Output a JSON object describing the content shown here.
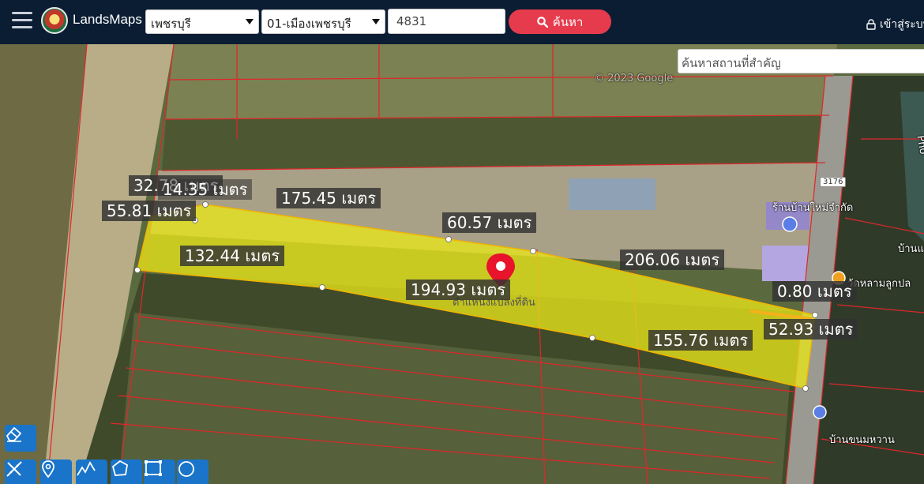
{
  "header": {
    "app_name": "LandsMaps",
    "province": "เพชรบุรี",
    "district": "01-เมืองเพชรบุรี",
    "parcel_no": "4831",
    "search_label": "ค้นหา",
    "login_label": "เข้าสู่ระบบ"
  },
  "map": {
    "place_search_placeholder": "ค้นหาสถานที่สำคัญ",
    "parcel_caption": "ตำแหน่งแปลงที่ดิน",
    "copyright": "© 2023 Google",
    "road_number": "3176",
    "poi": {
      "shop": "ร้านบ้านใหม่จำกัด",
      "village1": "บ้านแ",
      "village2": "บ้านขนมหวาน",
      "temple": "วัดหลามลูกปล",
      "river": "Pho"
    },
    "measurements": [
      {
        "id": "m1",
        "text": "32.78 เมตร"
      },
      {
        "id": "m2",
        "text": "14.35 เมตร"
      },
      {
        "id": "m3",
        "text": "175.45 เมตร"
      },
      {
        "id": "m4",
        "text": "55.81 เมตร"
      },
      {
        "id": "m5",
        "text": "60.57 เมตร"
      },
      {
        "id": "m6",
        "text": "132.44 เมตร"
      },
      {
        "id": "m7",
        "text": "206.06 เมตร"
      },
      {
        "id": "m8",
        "text": "194.93 เมตร"
      },
      {
        "id": "m9",
        "text": "0.80 เมตร"
      },
      {
        "id": "m10",
        "text": "52.93 เมตร"
      },
      {
        "id": "m11",
        "text": "155.76 เมตร"
      }
    ]
  },
  "tools": [
    {
      "id": "eraser",
      "icon": "eraser-icon"
    },
    {
      "id": "ruler",
      "icon": "ruler-icon"
    },
    {
      "id": "marker",
      "icon": "map-pin-icon"
    },
    {
      "id": "polyline",
      "icon": "polyline-icon"
    },
    {
      "id": "polygon",
      "icon": "polygon-icon"
    },
    {
      "id": "rectangle",
      "icon": "rectangle-icon"
    },
    {
      "id": "circle",
      "icon": "circle-icon"
    }
  ],
  "colors": {
    "topbar": "#0b1d33",
    "search_button": "#e63b4d",
    "parcel_fill": "#e8e51a",
    "plot_lines": "#e0262b",
    "tool_button": "#1a74c9"
  }
}
